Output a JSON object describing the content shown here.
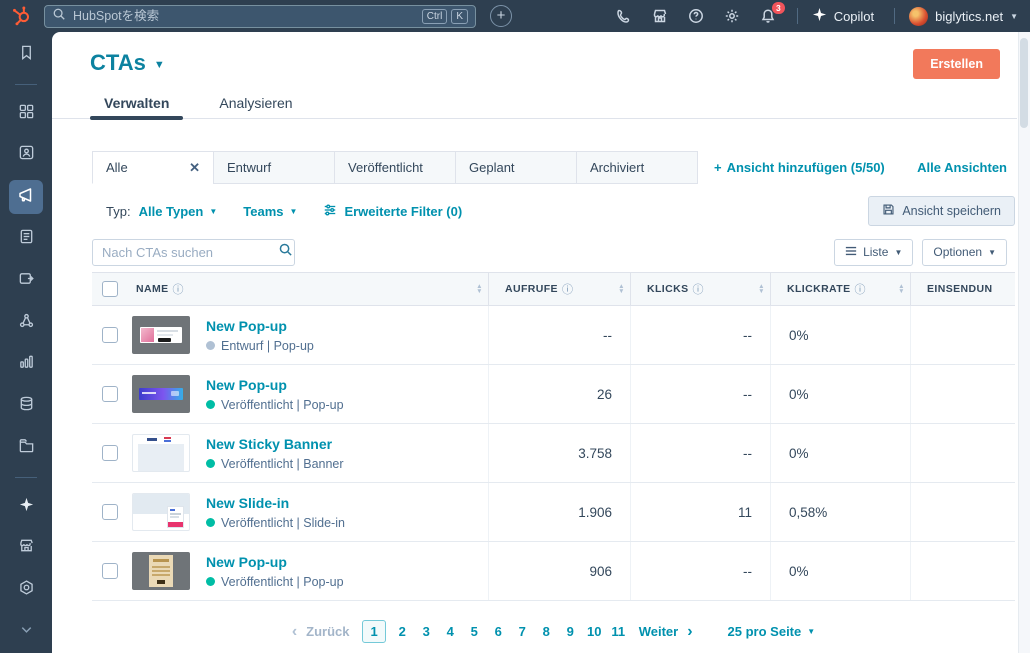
{
  "colors": {
    "nav_bg": "#2e3f50",
    "accent_orange": "#f2795b",
    "link_teal": "#0091ae",
    "published_green": "#00bda5",
    "draft_gray": "#b0c1d4",
    "badge_red": "#f2545b"
  },
  "topbar": {
    "search_placeholder": "HubSpotを検索",
    "shortcut_ctrl": "Ctrl",
    "shortcut_k": "K",
    "notification_badge": "3",
    "copilot_label": "Copilot",
    "account_name": "biglytics.net",
    "icons": [
      "hubspot-logo",
      "search-icon",
      "plus-icon",
      "phone-icon",
      "marketplace-icon",
      "help-icon",
      "settings-icon",
      "notifications-icon",
      "copilot-sparkle-icon",
      "avatar",
      "caret-down-icon"
    ]
  },
  "sidebar": {
    "icons": [
      "bookmark-icon",
      "workspaces-icon",
      "crm-icon",
      "marketing-icon",
      "content-icon",
      "commerce-icon",
      "automations-icon",
      "reporting-icon",
      "data-icon",
      "library-icon",
      "copilot-icon",
      "marketplace-icon",
      "settings-icon",
      "collapse-icon"
    ],
    "active_item": "marketing-icon"
  },
  "page": {
    "title": "CTAs",
    "create_label": "Erstellen",
    "tab_manage": "Verwalten",
    "tab_analyze": "Analysieren"
  },
  "views": {
    "tabs": [
      {
        "label": "Alle",
        "active": true
      },
      {
        "label": "Entwurf"
      },
      {
        "label": "Veröffentlicht"
      },
      {
        "label": "Geplant"
      },
      {
        "label": "Archiviert"
      }
    ],
    "add_label": "Ansicht hinzufügen (5/50)",
    "all_label": "Alle Ansichten"
  },
  "filters": {
    "type_label": "Typ:",
    "type_value": "Alle Typen",
    "teams_value": "Teams",
    "advanced_label": "Erweiterte Filter (0)",
    "save_view_label": "Ansicht speichern"
  },
  "toolbar": {
    "search_placeholder": "Nach CTAs suchen",
    "list_label": "Liste",
    "options_label": "Optionen"
  },
  "table": {
    "columns": [
      {
        "label": "NAME"
      },
      {
        "label": "AUFRUFE"
      },
      {
        "label": "KLICKS"
      },
      {
        "label": "KLICKRATE"
      },
      {
        "label": "EINSENDUN"
      }
    ],
    "rows": [
      {
        "name": "New Pop-up",
        "status_text": "Entwurf | Pop-up",
        "status_color": "#b0c1d4",
        "views": "--",
        "clicks": "--",
        "ctr": "0%"
      },
      {
        "name": "New Pop-up",
        "status_text": "Veröffentlicht | Pop-up",
        "status_color": "#00bda5",
        "views": "26",
        "clicks": "--",
        "ctr": "0%"
      },
      {
        "name": "New Sticky Banner",
        "status_text": "Veröffentlicht | Banner",
        "status_color": "#00bda5",
        "views": "3.758",
        "clicks": "--",
        "ctr": "0%"
      },
      {
        "name": "New Slide-in",
        "status_text": "Veröffentlicht | Slide-in",
        "status_color": "#00bda5",
        "views": "1.906",
        "clicks": "11",
        "ctr": "0,58%"
      },
      {
        "name": "New Pop-up",
        "status_text": "Veröffentlicht | Pop-up",
        "status_color": "#00bda5",
        "views": "906",
        "clicks": "--",
        "ctr": "0%"
      }
    ]
  },
  "pagination": {
    "prev": "Zurück",
    "pages": [
      "1",
      "2",
      "3",
      "4",
      "5",
      "6",
      "7",
      "8",
      "9",
      "10",
      "11"
    ],
    "current_page": "1",
    "next": "Weiter",
    "per_page": "25 pro Seite"
  }
}
